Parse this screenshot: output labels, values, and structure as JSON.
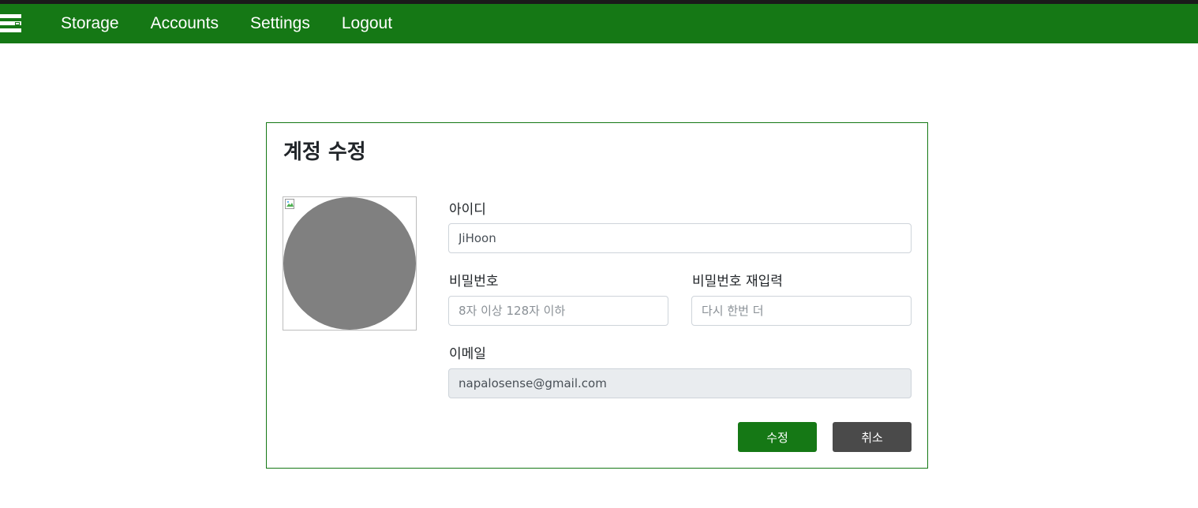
{
  "nav": {
    "items": [
      {
        "label": "Storage"
      },
      {
        "label": "Accounts"
      },
      {
        "label": "Settings"
      },
      {
        "label": "Logout"
      }
    ],
    "menu_icon": "hamburger-menu-icon",
    "color": "#157815"
  },
  "card": {
    "title": "계정 수정",
    "avatar": {
      "icon": "broken-image-icon",
      "color": "#808080"
    },
    "fields": {
      "id": {
        "label": "아이디",
        "value": "JiHoon"
      },
      "password": {
        "label": "비밀번호",
        "placeholder": "8자 이상 128자 이하",
        "value": ""
      },
      "password_confirm": {
        "label": "비밀번호 재입력",
        "placeholder": "다시 한번 더",
        "value": ""
      },
      "email": {
        "label": "이메일",
        "value": "napalosense@gmail.com",
        "disabled": true
      }
    },
    "buttons": {
      "submit": "수정",
      "cancel": "취소"
    }
  }
}
